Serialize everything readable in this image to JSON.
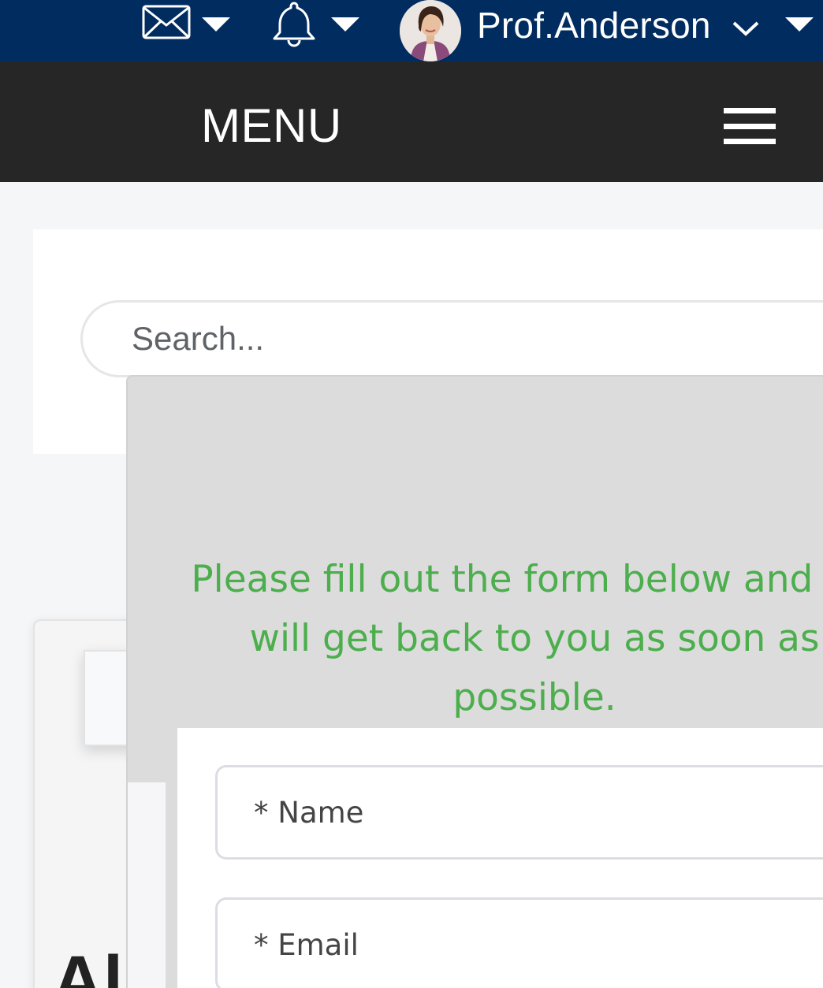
{
  "header": {
    "username": "Prof.Anderson",
    "icons": [
      "mail-icon",
      "bell-icon",
      "avatar",
      "chevron-down-icon",
      "caret-down-icon"
    ],
    "bg_color": "#012c5f"
  },
  "menu": {
    "label": "MENU",
    "bg_color": "#262626"
  },
  "search": {
    "placeholder": "Search..."
  },
  "background_card": {
    "heading": "Al"
  },
  "modal": {
    "message": "Please fill out the form below and we will get back to you as soon as possible.",
    "message_color": "#4cae4c",
    "fields": {
      "name_placeholder": "* Name",
      "email_placeholder": "* Email"
    }
  }
}
